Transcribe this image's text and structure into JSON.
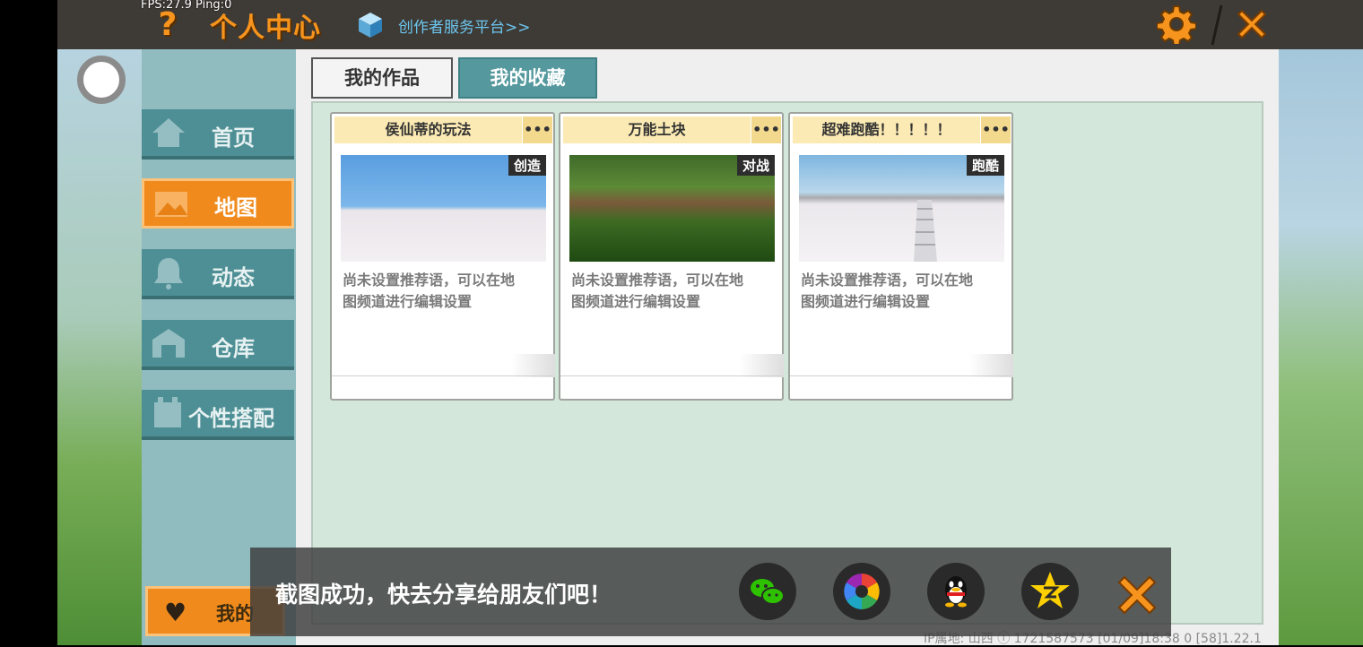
{
  "header": {
    "fps_text": "FPS:27.9  Ping:0",
    "help_glyph": "?",
    "title": "个人中心",
    "creator_link": "创作者服务平台>>"
  },
  "sidebar": {
    "items": [
      {
        "label": "首页",
        "icon": "home-icon"
      },
      {
        "label": "地图",
        "icon": "map-icon",
        "active": true
      },
      {
        "label": "动态",
        "icon": "bell-icon"
      },
      {
        "label": "仓库",
        "icon": "warehouse-icon"
      },
      {
        "label": "个性搭配",
        "icon": "outfit-icon"
      }
    ],
    "mine_label": "我的"
  },
  "tabs": [
    {
      "label": "我的作品",
      "selected": false
    },
    {
      "label": "我的收藏",
      "selected": true
    }
  ],
  "cards": [
    {
      "title": "侯仙蒂的玩法",
      "more": "•••",
      "tag": "创造",
      "desc_line1": "尚未设置推荐语，可以在地",
      "desc_line2": "图频道进行编辑设置"
    },
    {
      "title": "万能土块",
      "more": "•••",
      "tag": "对战",
      "desc_line1": "尚未设置推荐语，可以在地",
      "desc_line2": "图频道进行编辑设置"
    },
    {
      "title": "超难跑酷！！！！！",
      "more": "•••",
      "tag": "跑酷",
      "desc_line1": "尚未设置推荐语，可以在地",
      "desc_line2": "图频道进行编辑设置"
    }
  ],
  "toast": {
    "message": "截图成功，快去分享给朋友们吧！",
    "share_targets": [
      "wechat-icon",
      "moments-icon",
      "qq-icon",
      "qzone-icon"
    ]
  },
  "footer": {
    "info": "IP属地: 山西 ⓘ    1721587573   [01/09]18:38 0  [58]1.22.1"
  },
  "colors": {
    "accent_orange": "#f08a1c",
    "teal": "#4d8f95",
    "grid_bg": "#d3e8da"
  }
}
